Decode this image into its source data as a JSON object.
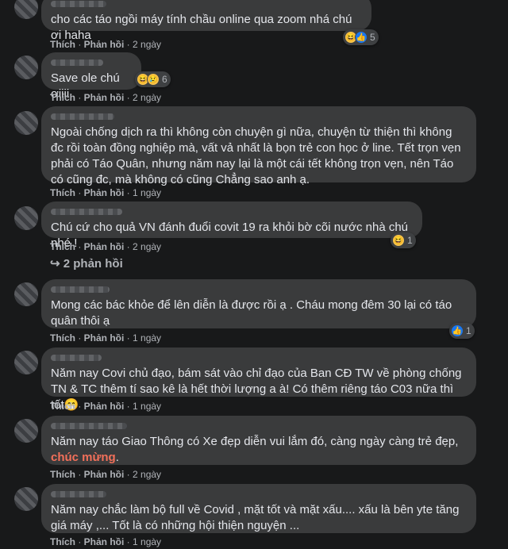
{
  "comments": [
    {
      "text": "cho các táo ngồi máy tính chầu online qua zoom nhá chú ơi haha",
      "like": "Thích",
      "reply": "Phản hồi",
      "time": "2 ngày",
      "react_count": "5",
      "reactions": [
        "haha-icon",
        "like-icon"
      ]
    },
    {
      "text": "Save ole chú ơiiii",
      "like": "Thích",
      "reply": "Phản hồi",
      "time": "2 ngày",
      "react_count": "6",
      "reactions": [
        "haha-icon",
        "sad-icon"
      ]
    },
    {
      "text": "Ngoài chống dịch ra thì không còn chuyện gì nữa, chuyện từ thiện thì không đc rồi toàn đồng nghiệp mà, vất vả nhất là bọn trẻ con học ở line. Tết trọn vẹn phải có Táo Quân, nhưng năm nay lại là một cái tết không trọn vẹn, nên Táo có cũng đc, mà không có cũng Chẳng sao anh ạ.",
      "like": "Thích",
      "reply": "Phản hồi",
      "time": "1 ngày"
    },
    {
      "text": "Chú cứ cho quả VN đánh đuổi covit 19 ra khỏi bờ cõi nước nhà chú nhé !",
      "like": "Thích",
      "reply": "Phản hồi",
      "time": "2 ngày",
      "react_count": "1",
      "reactions": [
        "haha-icon"
      ],
      "replies": "2 phản hồi"
    },
    {
      "text": "Mong các bác khỏe để lên diễn là được rồi ạ . Cháu mong đêm 30 lại có táo quân thôi ạ",
      "like": "Thích",
      "reply": "Phản hồi",
      "time": "1 ngày",
      "react_count": "1",
      "reactions": [
        "like-icon"
      ]
    },
    {
      "text": "Năm nay Covi chủ đạo, bám sát vào chỉ đạo của Ban CĐ TW về phòng chống TN & TC thêm tí sao kê là hết thời lượng a à! Có thêm riêng táo C03 nữa thì tốt😁",
      "like": "Thích",
      "reply": "Phản hồi",
      "time": "1 ngày"
    },
    {
      "text_pre": "Năm nay táo Giao Thông có Xe đẹp diễn vui lắm đó, càng ngày càng trẻ đẹp, ",
      "text_hl": "chúc mừng",
      "text_post": ".",
      "like": "Thích",
      "reply": "Phản hồi",
      "time": "2 ngày"
    },
    {
      "text": "Năm nay chắc làm bộ full về Covid , mặt tốt và mặt xấu.... xấu là bên yte tăng giá máy ,... Tốt là có những hội thiện nguyện ...",
      "like": "Thích",
      "reply": "Phản hồi",
      "time": "1 ngày"
    }
  ]
}
